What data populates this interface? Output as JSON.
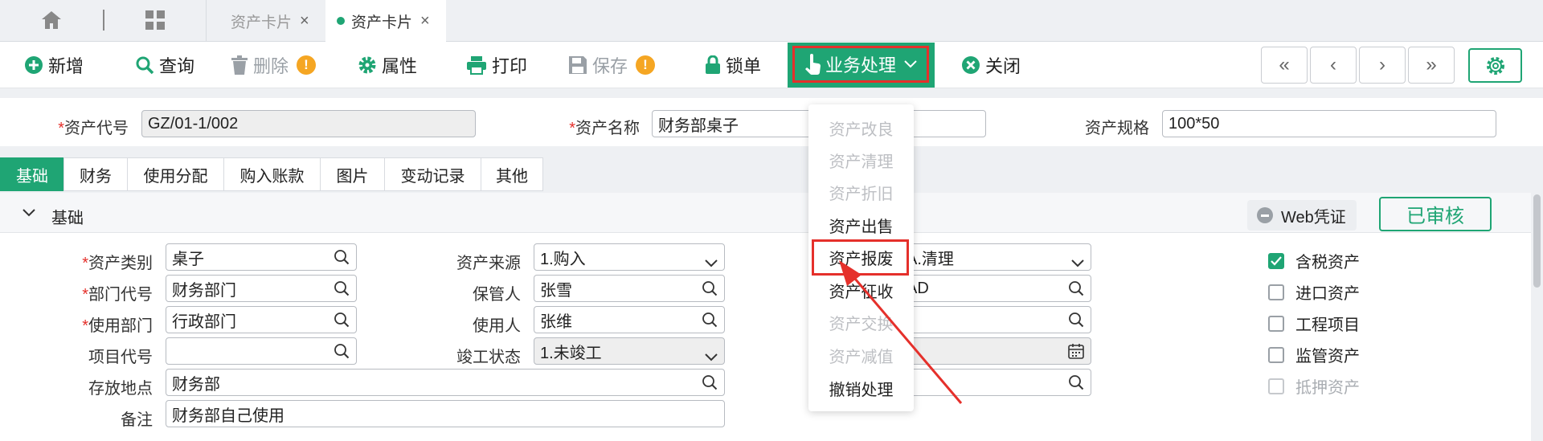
{
  "tabs": [
    {
      "label": "资产卡片",
      "active": false
    },
    {
      "label": "资产卡片",
      "active": true
    }
  ],
  "toolbar": {
    "add": "新增",
    "query": "查询",
    "delete": "删除",
    "props": "属性",
    "print": "打印",
    "save": "保存",
    "lock": "锁单",
    "business": "业务处理",
    "close": "关闭",
    "warn_mark": "!"
  },
  "nav": {
    "first": "«",
    "prev": "‹",
    "next": "›",
    "last": "»"
  },
  "header": {
    "code_label": "资产代号",
    "code_value": "GZ/01-1/002",
    "name_label": "资产名称",
    "name_value": "财务部桌子",
    "spec_label": "资产规格",
    "spec_value": "100*50",
    "required_mark": "*"
  },
  "subtabs": [
    "基础",
    "财务",
    "使用分配",
    "购入账款",
    "图片",
    "变动记录",
    "其他"
  ],
  "section": {
    "title": "基础",
    "web_voucher": "Web凭证",
    "status": "已审核"
  },
  "form": {
    "category_label": "资产类别",
    "category_value": "桌子",
    "dept_label": "部门代号",
    "dept_value": "财务部门",
    "usedept_label": "使用部门",
    "usedept_value": "行政部门",
    "project_label": "项目代号",
    "project_value": "",
    "location_label": "存放地点",
    "location_value": "财务部",
    "remark_label": "备注",
    "remark_value": "财务部自己使用",
    "source_label": "资产来源",
    "source_value": "1.购入",
    "keeper_label": "保管人",
    "keeper_value": "张雪",
    "user_label": "使用人",
    "user_value": "张维",
    "completion_label": "竣工状态",
    "completion_value": "1.未竣工",
    "col3_row1_value": "A.清理",
    "col3_row2_value": "AD"
  },
  "checkboxes": [
    {
      "label": "含税资产",
      "checked": true,
      "disabled": false
    },
    {
      "label": "进口资产",
      "checked": false,
      "disabled": false
    },
    {
      "label": "工程项目",
      "checked": false,
      "disabled": false
    },
    {
      "label": "监管资产",
      "checked": false,
      "disabled": false
    },
    {
      "label": "抵押资产",
      "checked": false,
      "disabled": true
    }
  ],
  "menu": [
    {
      "label": "资产改良",
      "disabled": true
    },
    {
      "label": "资产清理",
      "disabled": true
    },
    {
      "label": "资产折旧",
      "disabled": true
    },
    {
      "label": "资产出售",
      "disabled": false
    },
    {
      "label": "资产报废",
      "disabled": false
    },
    {
      "label": "资产征收",
      "disabled": false
    },
    {
      "label": "资产交换",
      "disabled": true
    },
    {
      "label": "资产减值",
      "disabled": true
    },
    {
      "label": "撤销处理",
      "disabled": false
    }
  ],
  "colors": {
    "accent": "#1fa574",
    "highlight": "#e5302b",
    "warning": "#f5a623"
  }
}
